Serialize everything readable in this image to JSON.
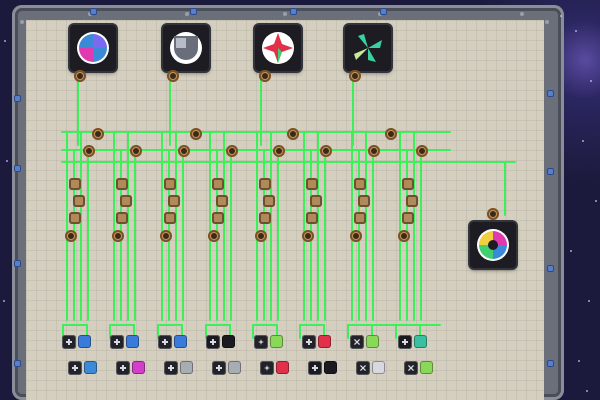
{
  "scene": "circuit-board",
  "wire_color": "#3cf05a",
  "board_color": "#d4cfbf",
  "top_symbols": [
    {
      "name": "quad-blue-symbol",
      "colors": [
        "#7a6af0",
        "#3a8ad8",
        "#e03ab0"
      ]
    },
    {
      "name": "shield-grey-symbol",
      "colors": [
        "#b8bcc8",
        "#6a6e7a"
      ]
    },
    {
      "name": "star-red-green-symbol",
      "colors": [
        "#e0304a",
        "#40d070"
      ]
    },
    {
      "name": "pinwheel-green-symbol",
      "colors": [
        "#3ad0a0",
        "#c8e8a0"
      ]
    }
  ],
  "right_symbol": {
    "name": "wheel-multicolor-symbol",
    "colors": [
      "#e03ab0",
      "#3a8ad8",
      "#40d070",
      "#f0d040"
    ]
  },
  "output_pairs": [
    {
      "top_icon": "plus",
      "top_color": "#3a7ad8",
      "bottom_icon": "plus",
      "bottom_color": "#3a8ad8"
    },
    {
      "top_icon": "plus",
      "top_color": "#3a7ad8",
      "bottom_icon": "plus",
      "bottom_color": "#d040c8"
    },
    {
      "top_icon": "plus",
      "top_color": "#3a7ad8",
      "bottom_icon": "plus",
      "bottom_color": "#a8acb4"
    },
    {
      "top_icon": "dark",
      "top_color": "#1a1a20",
      "bottom_icon": "plus",
      "bottom_color": "#a8acb4"
    },
    {
      "top_icon": "target",
      "top_color": "#8ad858",
      "bottom_icon": "target",
      "bottom_color": "#e0304a"
    },
    {
      "top_icon": "plus",
      "top_color": "#e0304a",
      "bottom_icon": "dark",
      "bottom_color": "#1a1a20"
    },
    {
      "top_icon": "cross",
      "top_color": "#8ad858",
      "bottom_icon": "cross",
      "bottom_color": "#d8d8e0"
    },
    {
      "top_icon": "dark",
      "top_color": "#3ac0a0",
      "bottom_icon": "cross",
      "bottom_color": "#8ad858"
    }
  ]
}
